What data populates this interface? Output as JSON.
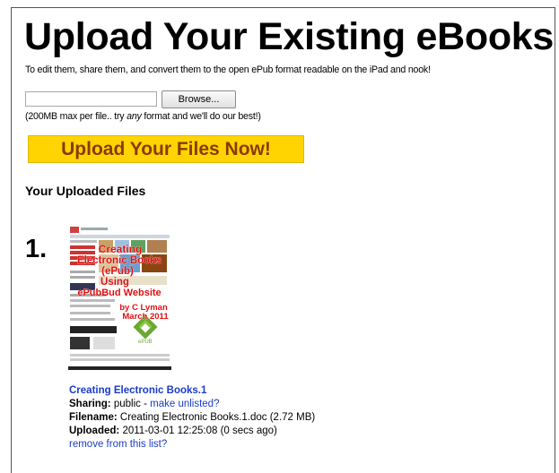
{
  "page": {
    "title": "Upload Your Existing eBooks",
    "subtitle": "To edit them, share them, and convert them to the open ePub format readable on the iPad and nook!"
  },
  "upload_form": {
    "file_input_value": "",
    "browse_label": "Browse...",
    "note_prefix": "(200MB max per file.. try ",
    "note_emphasis": "any",
    "note_suffix": " format and we'll do our best!)",
    "submit_label": "Upload Your Files Now!"
  },
  "uploaded": {
    "heading": "Your Uploaded Files",
    "files": [
      {
        "number": "1.",
        "thumbnail": {
          "title_lines": [
            "Creating",
            "Electronic Books",
            "(ePub)",
            "Using",
            "ePubBud Website"
          ],
          "byline": [
            "by C Lyman",
            "March 2011"
          ],
          "logo_text": "ePUB",
          "logo_icon": "epub-logo-icon"
        },
        "title": "Creating Electronic Books.1",
        "sharing_label": "Sharing:",
        "sharing_value": "public - ",
        "sharing_link": "make unlisted?",
        "filename_label": "Filename:",
        "filename_value": "Creating Electronic Books.1.doc (2.72 MB)",
        "uploaded_label": "Uploaded:",
        "uploaded_value": "2011-03-01 12:25:08 (0 secs ago)",
        "remove_link": "remove from this list?"
      }
    ]
  },
  "colors": {
    "upload_button_bg": "#ffd400",
    "upload_button_text": "#8a3a05",
    "link": "#1a3cc7",
    "thumb_title_red": "#e01010"
  }
}
